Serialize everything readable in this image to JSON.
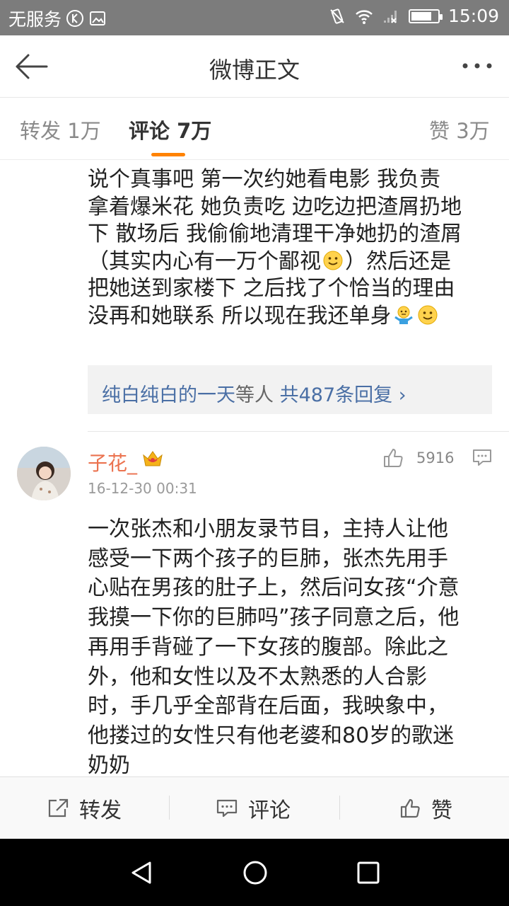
{
  "status_bar": {
    "carrier": "无服务",
    "time": "15:09",
    "battery_level": 0.78
  },
  "nav": {
    "title": "微博正文"
  },
  "tabs": {
    "repost": "转发 1万",
    "comment": "评论 7万",
    "like": "赞 3万"
  },
  "comments": [
    {
      "lines": [
        "说个真事吧  第一次约她看电影  我负责",
        "拿着爆米花 她负责吃  边吃边把渣屑扔地",
        "下  散场后 我偷偷地清理干净她扔的渣屑",
        "（其实内心有一万个鄙视",
        "）然后还是",
        "把她送到家楼下 之后找了个恰当的理由",
        "没再和她联系  所以现在我还单身"
      ],
      "replies": {
        "user": "纯白纯白的一天",
        "text": "等人",
        "count": "共487条回复 ›"
      }
    },
    {
      "username": "子花_",
      "timestamp": "16-12-30 00:31",
      "likes": "5916",
      "lines": [
        "一次张杰和小朋友录节目，主持人让他",
        "感受一下两个孩子的巨肺，张杰先用手",
        "心贴在男孩的肚子上，然后问女孩“介意",
        "我摸一下你的巨肺吗”孩子同意之后，他",
        "再用手背碰了一下女孩的腹部。除此之",
        "外，他和女性以及不太熟悉的人合影",
        "时，手几乎全部背在后面，我映象中，",
        "他搂过的女性只有他老婆和80岁的歌迷",
        "奶奶"
      ]
    }
  ],
  "toolbar": {
    "repost": "转发",
    "comment": "评论",
    "like": "赞"
  },
  "colors": {
    "accent": "#ff8200",
    "username": "#eb7350",
    "link": "#4a6fa5"
  }
}
